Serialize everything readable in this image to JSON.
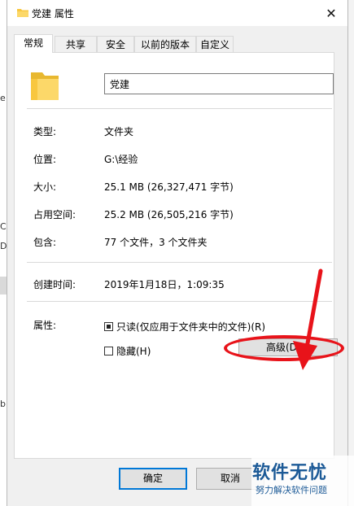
{
  "window": {
    "title": "党建 属性",
    "close_symbol": "✕"
  },
  "tabs": [
    {
      "label": "常规",
      "active": true
    },
    {
      "label": "共享"
    },
    {
      "label": "安全"
    },
    {
      "label": "以前的版本"
    },
    {
      "label": "自定义"
    }
  ],
  "general": {
    "name": "党建",
    "type": {
      "label": "类型:",
      "value": "文件夹"
    },
    "location": {
      "label": "位置:",
      "value": "G:\\经验"
    },
    "size": {
      "label": "大小:",
      "value": "25.1 MB (26,327,471 字节)"
    },
    "size_on_disk": {
      "label": "占用空间:",
      "value": "25.2 MB (26,505,216 字节)"
    },
    "contains": {
      "label": "包含:",
      "value": "77 个文件，3 个文件夹"
    },
    "created": {
      "label": "创建时间:",
      "value": "2019年1月18日，1:09:35"
    },
    "attributes": {
      "label": "属性:",
      "readonly": {
        "label": "只读(仅应用于文件夹中的文件)(R)",
        "checked": true
      },
      "hidden": {
        "label": "隐藏(H)",
        "checked": false
      },
      "advanced_button": "高级(D)..."
    }
  },
  "buttons": {
    "ok": "确定",
    "cancel": "取消"
  },
  "background": {
    "left_fragments": [
      "e",
      "C",
      "D",
      "b"
    ]
  },
  "watermark": {
    "title": "软件无忧",
    "subtitle": "努力解决软件问题"
  },
  "colors": {
    "annotation_red": "#e8131a",
    "primary_border": "#0078d7",
    "folder_yellow": "#f8c73f"
  }
}
